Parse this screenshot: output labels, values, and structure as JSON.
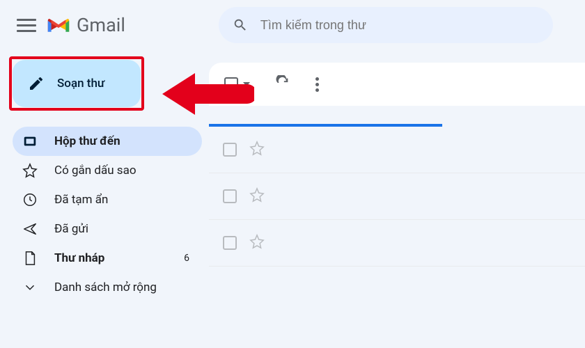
{
  "header": {
    "app_name": "Gmail",
    "search_placeholder": "Tìm kiếm trong thư"
  },
  "sidebar": {
    "compose_label": "Soạn thư",
    "items": [
      {
        "label": "Hộp thư đến",
        "icon": "inbox",
        "active": true,
        "bold": true
      },
      {
        "label": "Có gắn dấu sao",
        "icon": "star"
      },
      {
        "label": "Đã tạm ẩn",
        "icon": "clock"
      },
      {
        "label": "Đã gửi",
        "icon": "send"
      },
      {
        "label": "Thư nháp",
        "icon": "file",
        "count": "6",
        "bold": true
      },
      {
        "label": "Danh sách mở rộng",
        "icon": "chevron"
      }
    ]
  },
  "mail_rows": 3
}
